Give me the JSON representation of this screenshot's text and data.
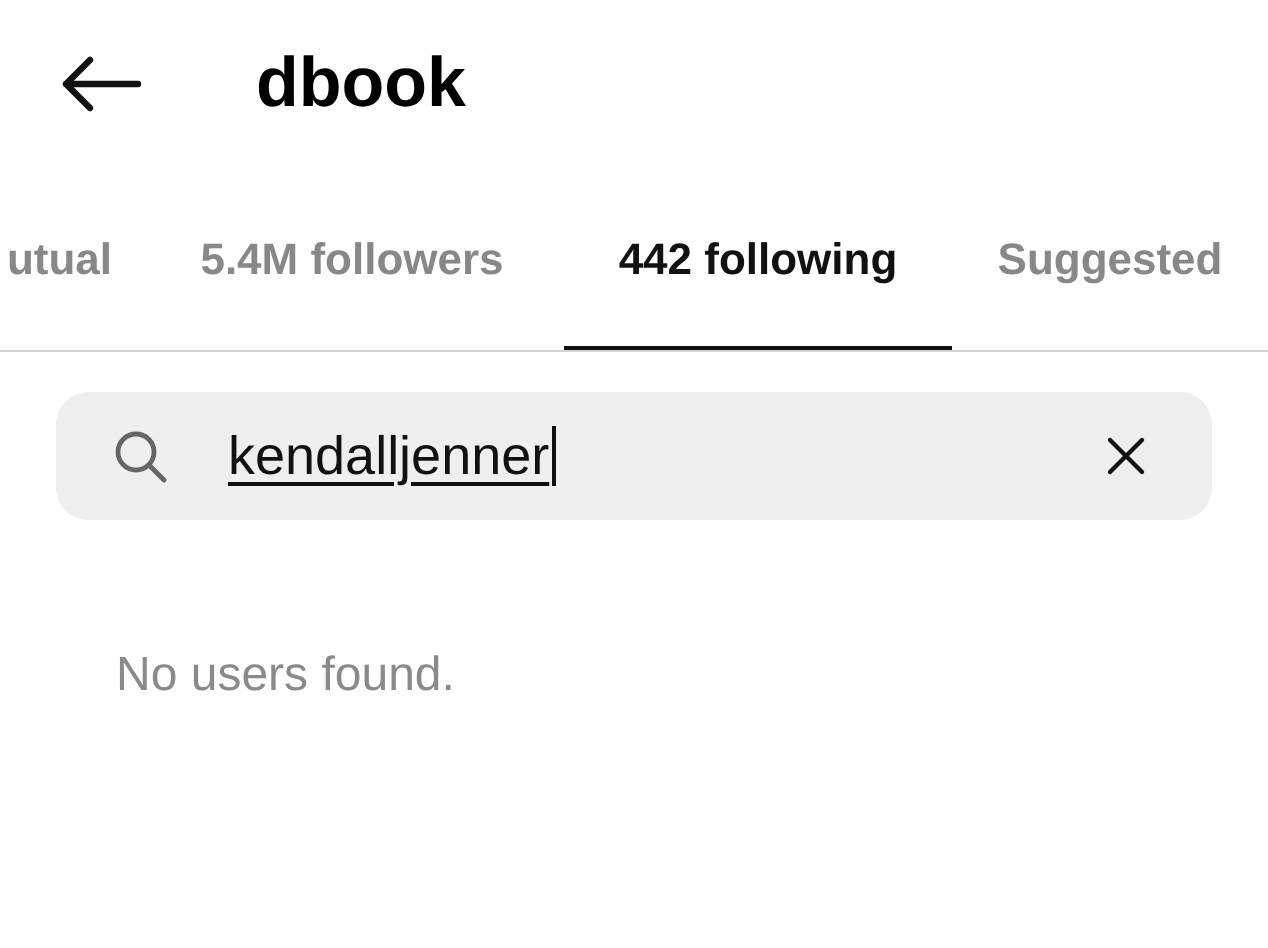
{
  "header": {
    "title": "dbook"
  },
  "tabs": [
    {
      "label": "utual",
      "selected": false
    },
    {
      "label": "5.4M followers",
      "selected": false
    },
    {
      "label": "442 following",
      "selected": true
    },
    {
      "label": "Suggested",
      "selected": false
    }
  ],
  "search": {
    "value": "kendalljenner"
  },
  "empty_message": "No users found."
}
